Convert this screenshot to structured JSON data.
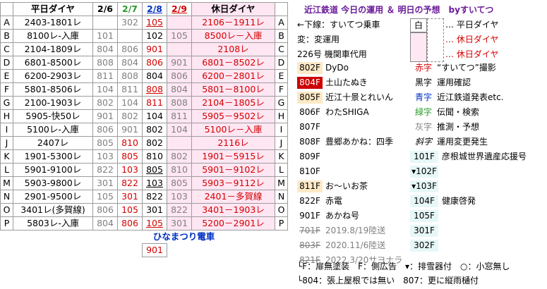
{
  "header": {
    "col_weekday": "平日ダイヤ",
    "d1": "2/6",
    "d2": "2/7",
    "d3": "2/8",
    "d4": "2/9",
    "col_holiday": "休日ダイヤ"
  },
  "rows": [
    {
      "code": "A",
      "name": "2403-1801レ",
      "v1": "",
      "v2": "302",
      "v3": "105",
      "v4": "",
      "hol": "2106－1911レ"
    },
    {
      "code": "B",
      "name": "8100レ-入庫",
      "v1": "101",
      "v2": "",
      "v3": "102",
      "v4": "105",
      "hol": "8500レ－入庫"
    },
    {
      "code": "C",
      "name": "2104-1809レ",
      "v1": "804",
      "v2": "806",
      "v3": "901",
      "v4": "",
      "hol": "2108レ"
    },
    {
      "code": "D",
      "name": "6801-8500レ",
      "v1": "808",
      "v2": "804",
      "v3": "806",
      "v4": "901",
      "hol": "6801－8502レ"
    },
    {
      "code": "E",
      "name": "6200-2903レ",
      "v1": "811",
      "v2": "808",
      "v3": "804",
      "v4": "806",
      "hol": "6200－2801レ"
    },
    {
      "code": "F",
      "name": "5801-8506レ",
      "v1": "104",
      "v2": "811",
      "v3": "808",
      "v4": "804",
      "hol": "5801－8100レ"
    },
    {
      "code": "G",
      "name": "2100-1903レ",
      "v1": "802",
      "v2": "104",
      "v3": "811",
      "v4": "808",
      "hol": "2104－1805レ"
    },
    {
      "code": "H",
      "name": "5905-快50レ",
      "v1": "901",
      "v2": "802",
      "v3": "104",
      "v4": "811",
      "hol": "5905－9502レ"
    },
    {
      "code": "I",
      "name": "5100レ-入庫",
      "v1": "806",
      "v2": "901",
      "v3": "802",
      "v4": "104",
      "hol": "5100レ－入庫"
    },
    {
      "code": "J",
      "name": "2407レ",
      "v1": "805",
      "v2": "810",
      "v3": "802",
      "v4": "",
      "hol": "2116レ"
    },
    {
      "code": "K",
      "name": "1901-5300レ",
      "v1": "103",
      "v2": "805",
      "v3": "810",
      "v4": "802",
      "hol": "1901－5915レ"
    },
    {
      "code": "L",
      "name": "5901-9100レ",
      "v1": "822",
      "v2": "103",
      "v3": "805",
      "v4": "810",
      "hol": "5901－9102レ"
    },
    {
      "code": "M",
      "name": "5903-9800レ",
      "v1": "301",
      "v2": "822",
      "v3": "103",
      "v4": "805",
      "hol": "5903－9112レ"
    },
    {
      "code": "N",
      "name": "2901-9500レ",
      "v1": "105",
      "v2": "301",
      "v3": "822",
      "v4": "103",
      "hol": "2401－多賀線"
    },
    {
      "code": "O",
      "name": "3401レ(多賀線)",
      "v1": "806",
      "v2": "105",
      "v3": "301",
      "v4": "822",
      "hol": "3401－1903レ"
    },
    {
      "code": "P",
      "name": "5803レ-入庫",
      "v1": "804",
      "v2": "806",
      "v3": "105",
      "v4": "301",
      "hol": "5200－2901レ"
    }
  ],
  "footer": {
    "event": "ひなまつり電車",
    "event_car": "901"
  },
  "right": {
    "title": "近江鉄道 今日の運用 ＆ 明日の予想　byすいてつ",
    "legend_top": [
      "←下線：すいてつ乗車",
      "変：変運用",
      "226号 機関車代用"
    ],
    "legend_white": "白",
    "legend_items": [
      "… 平日ダイヤ",
      "… 休日ダイヤ",
      "… 休日ダイヤ"
    ],
    "cars": [
      {
        "id": "802F",
        "label": "DyDo"
      },
      {
        "id": "804F",
        "label": "土山たぬき"
      },
      {
        "id": "805F",
        "label": "近江十景とれいん"
      },
      {
        "id": "806F",
        "label": "わたSHIGA"
      },
      {
        "id": "807F",
        "label": ""
      },
      {
        "id": "808F",
        "label": "豊郷あかね：四季"
      },
      {
        "id": "809F",
        "label": ""
      },
      {
        "id": "810F",
        "label": ""
      },
      {
        "id": "811F",
        "label": "お～いお茶"
      },
      {
        "id": "822F",
        "label": "赤電"
      },
      {
        "id": "901F",
        "label": "あかね号"
      },
      {
        "id": "701F",
        "label": "2019.8/19陸送"
      },
      {
        "id": "803F",
        "label": "2020.11/6陸送"
      },
      {
        "id": "821F",
        "label": "2022.3/20サヨナラ"
      }
    ],
    "colors": [
      {
        "word": "赤字",
        "desc": "“すいてつ”撮影"
      },
      {
        "word": "黒字",
        "desc": "運用確認"
      },
      {
        "word": "青字",
        "desc": "近江鉄道発表etc."
      },
      {
        "word": "緑字",
        "desc": "伝聞・検索"
      },
      {
        "word": "灰字",
        "desc": "推測・予想"
      },
      {
        "word": "斜字",
        "desc": "運用変更発生"
      }
    ],
    "small_cars": [
      {
        "id": "101F",
        "label": "彦根城世界遺産応援号"
      },
      {
        "id": "▾102F",
        "label": ""
      },
      {
        "id": "▾103F",
        "label": ""
      },
      {
        "id": "104F",
        "label": "健康啓発"
      },
      {
        "id": "105F",
        "label": ""
      },
      {
        "id": "301F",
        "label": ""
      },
      {
        "id": "302F",
        "label": ""
      }
    ],
    "notes": [
      "└F：扉無塗装　F：側広告　▾：排雪器付　○：小窓無し",
      "└804：張上屋根では無い　807：更に縦雨樋付"
    ]
  },
  "colors": {
    "red": "#d40000",
    "blue": "#0030c0",
    "green": "#2a9a2a",
    "gray": "#808080",
    "pink": "#ffe6f3"
  }
}
